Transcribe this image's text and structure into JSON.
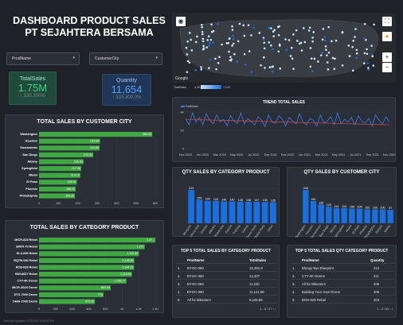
{
  "header": {
    "title_line1": "DASHBOARD PRODUCT SALES",
    "title_line2": "PT SEJAHTERA BERSAMA"
  },
  "filters": {
    "prodname": "ProdName",
    "customercity": "CustomerCity"
  },
  "kpis": {
    "total_sales": {
      "label": "TotalSales",
      "value": "1.75M",
      "sub": "↑ 333,300%"
    },
    "quantity": {
      "label": "Quantity",
      "value": "11,654",
      "sub": "↑ 333,300.0%"
    }
  },
  "map": {
    "google_label": "Google",
    "legend_label": "TotalSales",
    "legend_min": "4.45",
    "legend_max": "7,143",
    "fullscreen_icon": "fullscreen-icon",
    "pegman_icon": "pegman-icon",
    "zoom_in": "+",
    "zoom_out": "−"
  },
  "trend": {
    "title": "TREND TOTAL SALES",
    "legend": "TotalSales",
    "x_labels": [
      "Nov 2019",
      "Jan 2020",
      "Mar 2020",
      "May 2020",
      "Jul 2020",
      "Sep 2020",
      "Nov 2020",
      "Jan 2021",
      "Mar 2021",
      "May 2021",
      "Jul 2021",
      "Sep 2021",
      "Nov 2021"
    ],
    "y_labels": [
      "4K",
      "2K",
      "0"
    ]
  },
  "city_chart": {
    "title": "TOTAL SALES BY CUSTOMER CITY",
    "x_ticks": [
      "0",
      "100",
      "200",
      "300",
      "400",
      "500",
      "600"
    ]
  },
  "category_chart": {
    "title": "TOTAL SALES BY CATEGORY PRODUCT",
    "x_ticks": [
      "0",
      "200",
      "400",
      "600",
      "800",
      "1K",
      "1.2K",
      "1.4K"
    ]
  },
  "qty_category": {
    "title": "QTY SALES BY CATEGORY PRODUCT"
  },
  "qty_city": {
    "title": "QTY SALES BY CUSTOMER CITY"
  },
  "top5_sales": {
    "title": "TOP 5 TOTAL SALES BY CATEGORY PRODUCT",
    "headers": [
      "ProdName",
      "TotalSales"
    ],
    "rows": [
      {
        "n": "1.",
        "name": "BYOC-060",
        "val": "15,391.8"
      },
      {
        "n": "2.",
        "name": "BYOC-050",
        "val": "14,307"
      },
      {
        "n": "3.",
        "name": "BYOC-083",
        "val": "11,230"
      },
      {
        "n": "4.",
        "name": "BYOC-090",
        "val": "11,141.86"
      },
      {
        "n": "5.",
        "name": "All for Bikesters",
        "val": "9,165.85"
      }
    ],
    "pager": "1 - 5 / 27"
  },
  "top5_qty": {
    "title": "TOP 5 TOTAL SALES QTY CATEGORY PRODUCT",
    "headers": [
      "ProdName",
      "Quantity"
    ],
    "rows": [
      {
        "n": "1.",
        "name": "Bloopy Bye Blueprint",
        "val": "212"
      },
      {
        "n": "2.",
        "name": "CTY-4K Drame",
        "val": "211"
      },
      {
        "n": "3.",
        "name": "All for Bikesters",
        "val": "205"
      },
      {
        "n": "4.",
        "name": "Building Your Own Drone",
        "val": "205"
      },
      {
        "n": "5.",
        "name": "BOS-828 Rebel",
        "val": "203"
      }
    ],
    "pager": "1 - 5 / 80"
  },
  "footer": "Data last updated: 2/23/2022 5:05:03 PM",
  "chart_data": [
    {
      "type": "bar",
      "title": "TOTAL SALES BY CUSTOMER CITY",
      "categories": [
        "Washington",
        "Houston",
        "Sacramento",
        "San Diego",
        "Albany",
        "Springfield",
        "Miami",
        "El Paso",
        "Phoenix",
        "Philadelphia"
      ],
      "values": [
        584.6,
        314.84,
        312.66,
        279.9,
        230.03,
        217.4,
        213.19,
        195.02,
        189.12,
        185.28
      ],
      "value_labels": [
        "584.59",
        "314.84",
        "312.66",
        "279.90",
        "230.03",
        "217.40",
        "213.19",
        "195.02",
        "189.12",
        "185.28"
      ],
      "xlim": [
        0,
        600
      ],
      "color": "#3fa843"
    },
    {
      "type": "bar",
      "title": "TOTAL SALES BY CATEGORY PRODUCT",
      "categories": [
        "MICR-828 Rebel",
        "BWVI-70 Rebel",
        "SLX-600 Rebel",
        "RQTB-940 Rebel",
        "RCB-828 Rebel",
        "SWI-8827 Rebel",
        "CTY-4K Drone",
        "MICR-404X Drone",
        "DTX-7000 Drone",
        "OHIA-7000 Drone"
      ],
      "values": [
        1476.8,
        1272,
        1202.49,
        1146.89,
        1144.32,
        1118.99,
        1052.77,
        863.04,
        776.1,
        673.3
      ],
      "value_labels": [
        "1,47...",
        "1,272",
        "1,202.49",
        "1,146.89",
        "1,144.32",
        "1,118.99",
        "1,052.77",
        "863.04",
        "776",
        "673.30"
      ],
      "xlim": [
        0,
        1400
      ],
      "color": "#3fa843"
    },
    {
      "type": "bar",
      "title": "QTY SALES BY CATEGORY PRODUCT",
      "categories": [
        "Blueprint",
        "Drone Kits",
        "Drones",
        "eBooks",
        "Robot Kits",
        "Robots",
        "Training",
        "Videos",
        "Drone Parts",
        "Robot Parts",
        "Other"
      ],
      "values": [
        213,
        150,
        144,
        143,
        140,
        140,
        138,
        138,
        137,
        136,
        135
      ],
      "color": "#1a6fe0"
    },
    {
      "type": "bar",
      "title": "QTY SALES BY CUSTOMER CITY",
      "categories": [
        "Washington",
        "Houston",
        "Sacramento",
        "San Diego",
        "Albany",
        "Springfield",
        "Miami",
        "El Paso",
        "Phoenix",
        "Philadelphia",
        "Denver",
        "Dallas"
      ],
      "values": [
        240,
        160,
        135,
        120,
        110,
        110,
        105,
        105,
        100,
        100,
        100,
        97
      ],
      "color": "#1a6fe0"
    },
    {
      "type": "line",
      "title": "TREND TOTAL SALES",
      "series": [
        {
          "name": "TotalSales",
          "values": [
            3.3,
            2.6,
            3.9,
            2.9,
            3.4,
            2.6,
            3.8,
            3.1,
            2.7,
            3.7,
            2.9,
            3.2,
            2.5,
            3.6,
            3.0,
            2.8,
            3.9,
            2.7,
            3.3,
            3.0,
            2.6,
            3.5,
            3.1,
            2.4,
            3.7,
            2.9,
            2.8,
            3.6,
            3.2,
            2.5,
            3.4,
            3.0,
            2.7,
            3.8,
            2.9,
            2.6,
            3.3,
            3.1,
            2.5,
            3.7,
            2.8,
            3.0,
            3.5,
            2.6,
            3.9,
            2.7,
            3.2,
            2.9,
            3.4,
            2.6,
            3.6,
            3.0,
            2.8,
            3.3,
            2.5,
            3.7,
            3.1,
            2.7,
            3.5,
            2.9
          ]
        }
      ],
      "trend_line": [
        3.2,
        2.6
      ],
      "ylim": [
        0,
        4
      ]
    }
  ]
}
